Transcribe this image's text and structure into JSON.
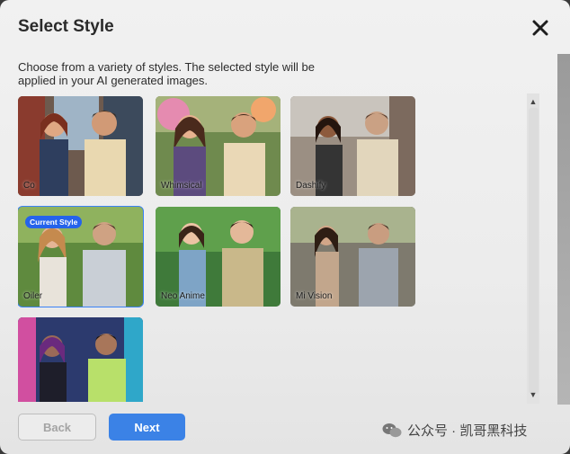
{
  "dialog": {
    "title": "Select Style",
    "description": "Choose from a variety of styles. The selected style will be applied in your AI generated images."
  },
  "styles": [
    {
      "label": "Co",
      "current": false
    },
    {
      "label": "Whimsical",
      "current": false
    },
    {
      "label": "Dashify",
      "current": false
    },
    {
      "label": "Oiler",
      "current": true,
      "badge": "Current Style"
    },
    {
      "label": "Neo Anime",
      "current": false
    },
    {
      "label": "Mi Vision",
      "current": false
    },
    {
      "label": "",
      "current": false
    }
  ],
  "buttons": {
    "back": "Back",
    "next": "Next"
  },
  "watermark": {
    "text": "公众号 · 凯哥黑科技"
  },
  "colors": {
    "accent": "#3b82e6",
    "badge": "#2563eb"
  }
}
